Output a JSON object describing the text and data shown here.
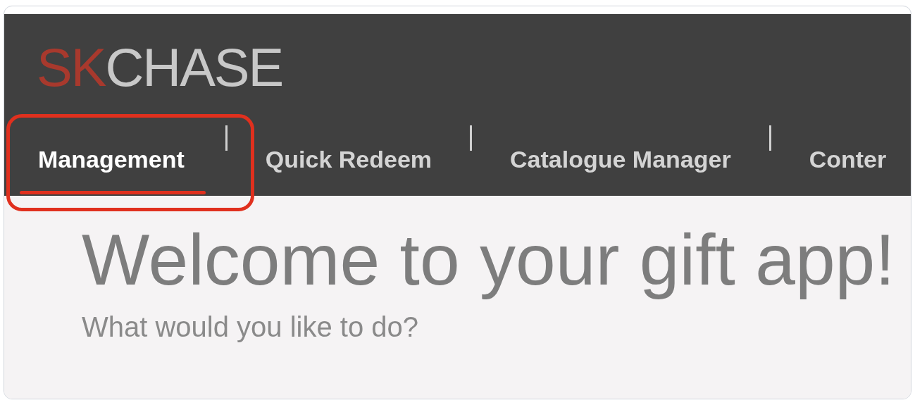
{
  "logo": {
    "accent": "SK",
    "rest": "CHASE"
  },
  "tabs": [
    {
      "label": "Management",
      "selected": true
    },
    {
      "label": "Quick Redeem",
      "selected": false
    },
    {
      "label": "Catalogue Manager",
      "selected": false
    },
    {
      "label": "Conter",
      "selected": false
    }
  ],
  "heading": "Welcome to your gift app!",
  "subheading": "What would you like to do?"
}
